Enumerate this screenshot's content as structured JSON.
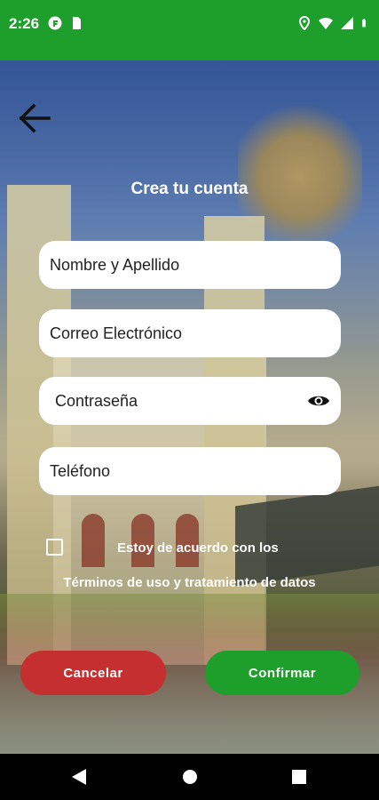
{
  "status_bar": {
    "time": "2:26",
    "left_icons": [
      "f-app-icon",
      "sd-card-icon"
    ],
    "right_icons": [
      "location-icon",
      "wifi-icon",
      "signal-icon",
      "battery-icon"
    ],
    "color": "#1e9e2a"
  },
  "screen": {
    "title": "Crea tu cuenta",
    "back_icon": "arrow-left-icon"
  },
  "form": {
    "name_placeholder": "Nombre y Apellido",
    "email_placeholder": "Correo Electrónico",
    "password_placeholder": "Contraseña",
    "phone_placeholder": "Teléfono",
    "password_toggle_icon": "eye-icon"
  },
  "agreement": {
    "checked": false,
    "label": "Estoy de acuerdo con los",
    "terms_link": "Términos de uso y tratamiento de datos"
  },
  "actions": {
    "cancel_label": "Cancelar",
    "confirm_label": "Confirmar",
    "cancel_color": "#c62f2f",
    "confirm_color": "#1e9e2a"
  },
  "nav_bar": {
    "icons": [
      "back-triangle-icon",
      "home-circle-icon",
      "recents-square-icon"
    ]
  }
}
